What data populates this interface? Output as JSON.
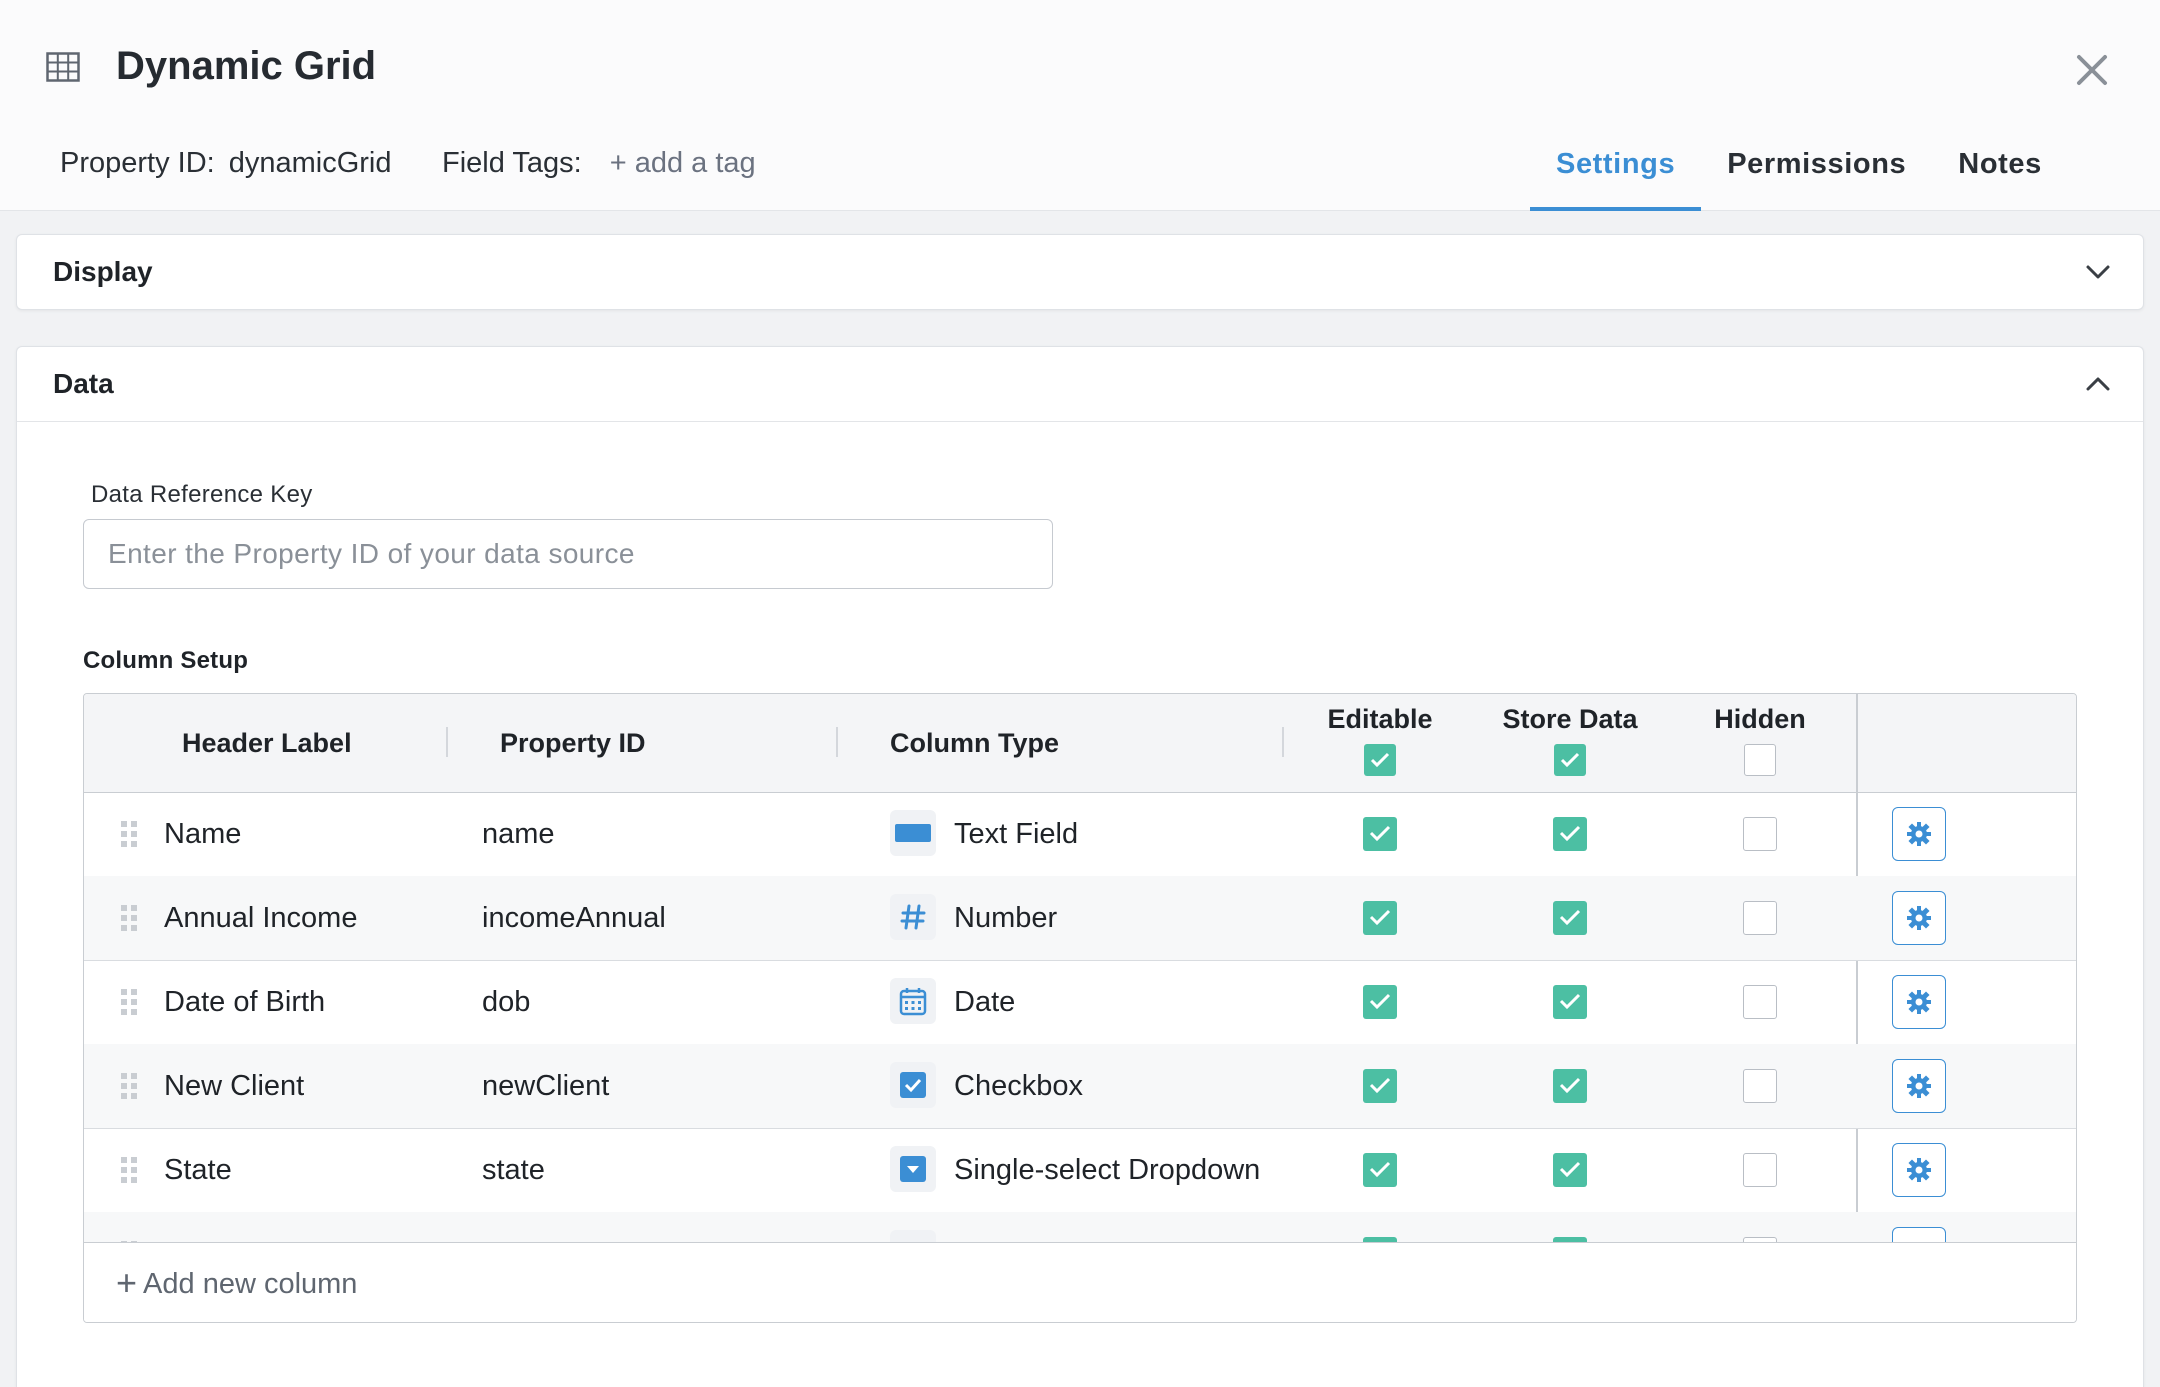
{
  "header": {
    "title": "Dynamic Grid",
    "property_id_label": "Property ID:",
    "property_id_value": "dynamicGrid",
    "field_tags_label": "Field Tags:",
    "add_tag_label": "+ add a tag",
    "icon": "grid-table-icon"
  },
  "tabs": [
    {
      "label": "Settings",
      "active": true
    },
    {
      "label": "Permissions",
      "active": false
    },
    {
      "label": "Notes",
      "active": false
    }
  ],
  "panels": {
    "display": {
      "title": "Display",
      "expanded": false
    },
    "data": {
      "title": "Data",
      "expanded": true
    }
  },
  "data_reference": {
    "label": "Data Reference Key",
    "placeholder": "Enter the Property ID of your data source",
    "value": ""
  },
  "column_setup": {
    "label": "Column Setup",
    "headers": {
      "header_label": "Header Label",
      "property_id": "Property ID",
      "column_type": "Column Type",
      "editable": "Editable",
      "store_data": "Store Data",
      "hidden": "Hidden"
    },
    "header_checks": {
      "editable": true,
      "store_data": true,
      "hidden": false
    },
    "rows": [
      {
        "label": "Name",
        "property_id": "name",
        "type": "Text Field",
        "type_icon": "text-field-icon",
        "editable": true,
        "store_data": true,
        "hidden": false
      },
      {
        "label": "Annual Income",
        "property_id": "incomeAnnual",
        "type": "Number",
        "type_icon": "hash-icon",
        "editable": true,
        "store_data": true,
        "hidden": false
      },
      {
        "label": "Date of Birth",
        "property_id": "dob",
        "type": "Date",
        "type_icon": "calendar-icon",
        "editable": true,
        "store_data": true,
        "hidden": false
      },
      {
        "label": "New Client",
        "property_id": "newClient",
        "type": "Checkbox",
        "type_icon": "checkbox-icon",
        "editable": true,
        "store_data": true,
        "hidden": false
      },
      {
        "label": "State",
        "property_id": "state",
        "type": "Single-select Dropdown",
        "type_icon": "dropdown-icon",
        "editable": true,
        "store_data": true,
        "hidden": false
      }
    ],
    "add_column_label": "Add new column"
  },
  "colors": {
    "accent": "#3b8ed4",
    "check_on": "#4cbfa3"
  }
}
